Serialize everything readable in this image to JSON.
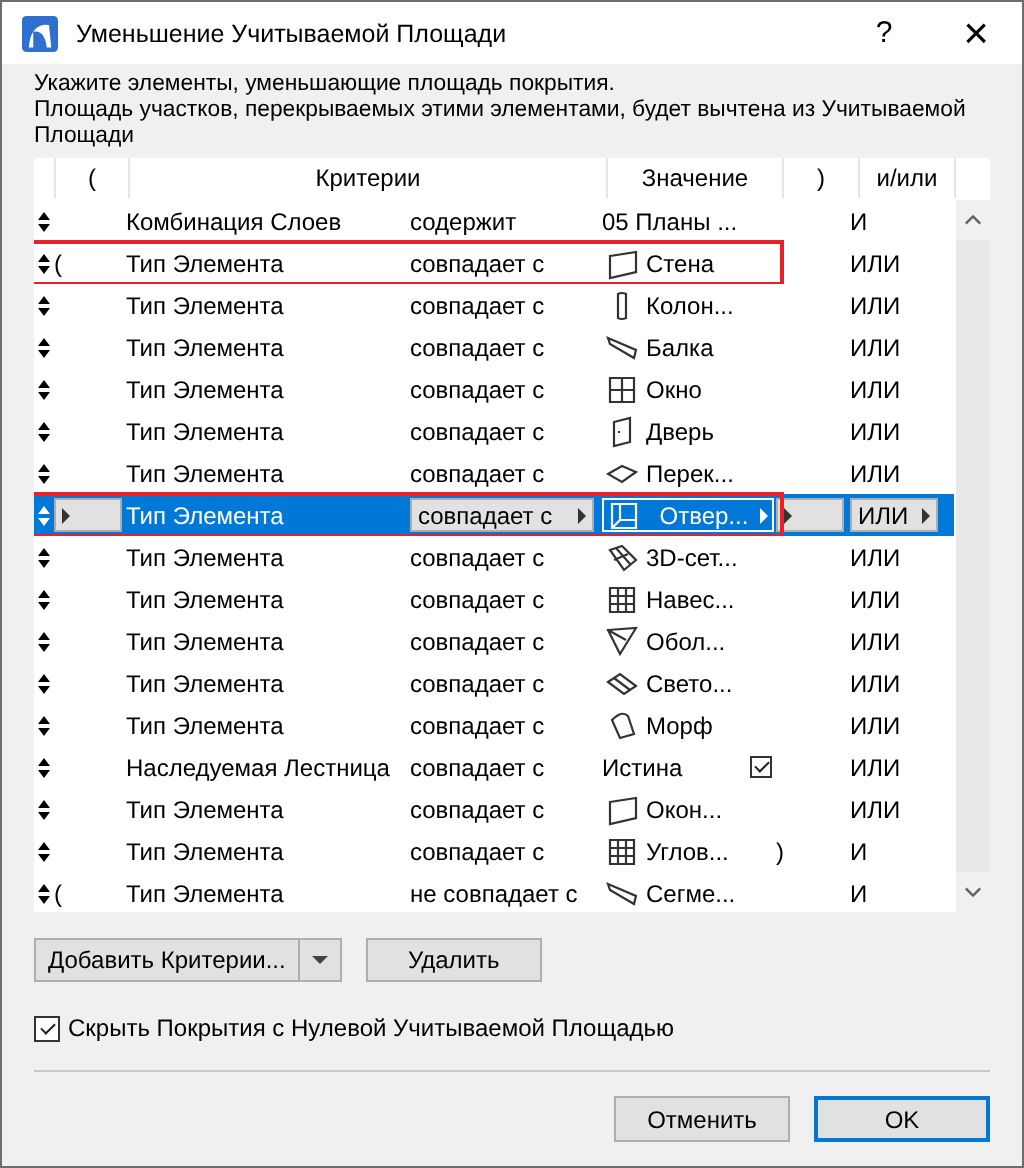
{
  "window": {
    "title": "Уменьшение Учитываемой Площади",
    "help": "?",
    "close": "×"
  },
  "intro": [
    "Укажите элементы, уменьшающие площадь покрытия.",
    "Площадь участков, перекрываемых этими элементами, будет вычтена из Учитываемой",
    "Площади"
  ],
  "table": {
    "columns": [
      "(",
      "Критерии",
      "Значение",
      ")",
      "и/или"
    ],
    "rows": [
      {
        "open": "",
        "criterion": "Комбинация Слоев",
        "operator": "содержит",
        "value": "05 Планы ...",
        "kind": "text",
        "close": "",
        "logic": "И",
        "selected": false,
        "highlighted": false
      },
      {
        "open": "(",
        "criterion": "Тип Элемента",
        "operator": "совпадает с",
        "value": "Стена",
        "kind": "wall",
        "close": "",
        "logic": "ИЛИ",
        "selected": false,
        "highlighted": true
      },
      {
        "open": "",
        "criterion": "Тип Элемента",
        "operator": "совпадает с",
        "value": "Колон...",
        "kind": "column",
        "close": "",
        "logic": "ИЛИ",
        "selected": false,
        "highlighted": false
      },
      {
        "open": "",
        "criterion": "Тип Элемента",
        "operator": "совпадает с",
        "value": "Балка",
        "kind": "beam",
        "close": "",
        "logic": "ИЛИ",
        "selected": false,
        "highlighted": false
      },
      {
        "open": "",
        "criterion": "Тип Элемента",
        "operator": "совпадает с",
        "value": "Окно",
        "kind": "window",
        "close": "",
        "logic": "ИЛИ",
        "selected": false,
        "highlighted": false
      },
      {
        "open": "",
        "criterion": "Тип Элемента",
        "operator": "совпадает с",
        "value": "Дверь",
        "kind": "door",
        "close": "",
        "logic": "ИЛИ",
        "selected": false,
        "highlighted": false
      },
      {
        "open": "",
        "criterion": "Тип Элемента",
        "operator": "совпадает с",
        "value": "Перек...",
        "kind": "slab",
        "close": "",
        "logic": "ИЛИ",
        "selected": false,
        "highlighted": false
      },
      {
        "open": "",
        "criterion": "Тип Элемента",
        "operator": "совпадает с",
        "value": "Отвер...",
        "kind": "opening",
        "close": "",
        "logic": "ИЛИ",
        "selected": true,
        "highlighted": true
      },
      {
        "open": "",
        "criterion": "Тип Элемента",
        "operator": "совпадает с",
        "value": "3D-сет...",
        "kind": "mesh",
        "close": "",
        "logic": "ИЛИ",
        "selected": false,
        "highlighted": false
      },
      {
        "open": "",
        "criterion": "Тип Элемента",
        "operator": "совпадает с",
        "value": "Навес...",
        "kind": "grid",
        "close": "",
        "logic": "ИЛИ",
        "selected": false,
        "highlighted": false
      },
      {
        "open": "",
        "criterion": "Тип Элемента",
        "operator": "совпадает с",
        "value": "Обол...",
        "kind": "shell",
        "close": "",
        "logic": "ИЛИ",
        "selected": false,
        "highlighted": false
      },
      {
        "open": "",
        "criterion": "Тип Элемента",
        "operator": "совпадает с",
        "value": "Свето...",
        "kind": "skylight",
        "close": "",
        "logic": "ИЛИ",
        "selected": false,
        "highlighted": false
      },
      {
        "open": "",
        "criterion": "Тип Элемента",
        "operator": "совпадает с",
        "value": "Морф",
        "kind": "morph",
        "close": "",
        "logic": "ИЛИ",
        "selected": false,
        "highlighted": false
      },
      {
        "open": "",
        "criterion": "Наследуемая Лестница",
        "operator": "совпадает с",
        "value": "Истина",
        "kind": "text",
        "checked": true,
        "close": "",
        "logic": "ИЛИ",
        "selected": false,
        "highlighted": false
      },
      {
        "open": "",
        "criterion": "Тип Элемента",
        "operator": "совпадает с",
        "value": "Окон...",
        "kind": "wall",
        "close": "",
        "logic": "ИЛИ",
        "selected": false,
        "highlighted": false
      },
      {
        "open": "",
        "criterion": "Тип Элемента",
        "operator": "совпадает с",
        "value": "Углов...",
        "kind": "grid",
        "close": ")",
        "logic": "И",
        "selected": false,
        "highlighted": false
      },
      {
        "open": "(",
        "criterion": "Тип Элемента",
        "operator": "не совпадает с",
        "value": "Сегме...",
        "kind": "beam",
        "close": "",
        "logic": "И",
        "selected": false,
        "highlighted": false
      }
    ]
  },
  "buttons": {
    "add": "Добавить Критерии...",
    "delete": "Удалить"
  },
  "hide_zero": {
    "label": "Скрыть Покрытия с Нулевой Учитываемой Площадью",
    "checked": true
  },
  "footer": [
    {
      "label": "Отменить",
      "default": false
    },
    {
      "label": "OK",
      "default": true
    }
  ]
}
